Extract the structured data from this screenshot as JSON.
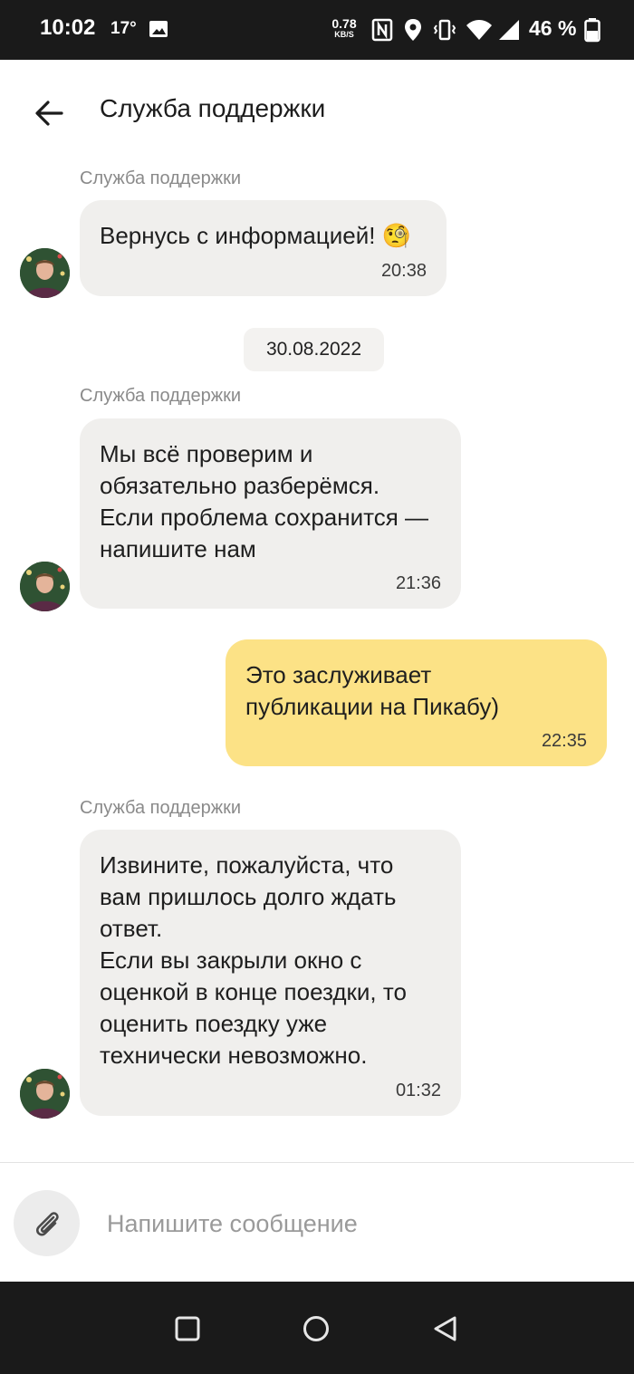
{
  "status_bar": {
    "time": "10:02",
    "temperature": "17°",
    "net_speed": "0.78",
    "net_unit": "KB/S",
    "battery": "46 %"
  },
  "header": {
    "title": "Служба поддержки"
  },
  "chat": {
    "date_separator": "30.08.2022",
    "messages": [
      {
        "sender": "Служба поддержки",
        "text": "Вернусь с информацией! 🧐",
        "time": "20:38"
      },
      {
        "sender": "Служба поддержки",
        "text": "Мы всё проверим и\nобязательно разберёмся.\nЕсли проблема сохранится —\nнапишите нам",
        "time": "21:36"
      },
      {
        "text": "Это заслуживает\nпубликации на Пикабу)",
        "time": "22:35"
      },
      {
        "sender": "Служба поддержки",
        "text": "Извините, пожалуйста, что\nвам пришлось долго ждать\nответ.\nЕсли вы закрыли окно с\nоценкой в конце поездки, то\nоценить поездку уже\nтехнически невозможно.",
        "time": "01:32"
      }
    ]
  },
  "composer": {
    "placeholder": "Напишите сообщение"
  },
  "colors": {
    "own_bubble": "#fce286",
    "other_bubble": "#f0efed",
    "system_bars": "#1a1a1a"
  }
}
